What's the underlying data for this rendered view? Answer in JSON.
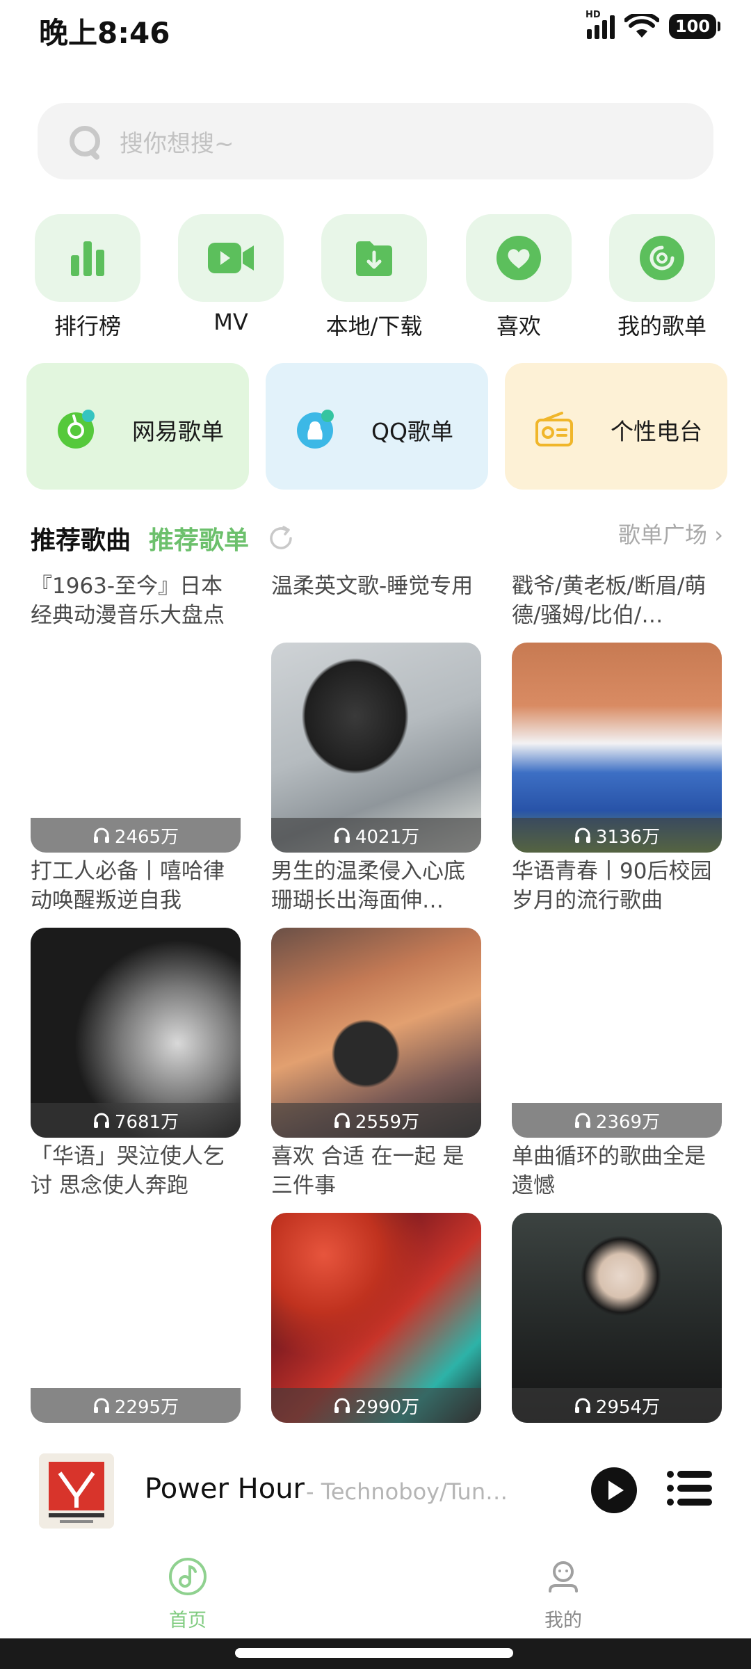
{
  "status_bar": {
    "time": "晚上8:46",
    "battery": "100",
    "network": "HD"
  },
  "search": {
    "placeholder": "搜你想搜~"
  },
  "quick_entries": [
    {
      "label": "排行榜",
      "icon": "chart-bars-icon"
    },
    {
      "label": "MV",
      "icon": "video-camera-icon"
    },
    {
      "label": "本地/下载",
      "icon": "download-folder-icon"
    },
    {
      "label": "喜欢",
      "icon": "heart-icon"
    },
    {
      "label": "我的歌单",
      "icon": "disc-icon"
    }
  ],
  "sources": [
    {
      "label": "网易歌单",
      "icon": "netease-icon",
      "color": "#e2f6de"
    },
    {
      "label": "QQ歌单",
      "icon": "qq-icon",
      "color": "#e2f2fa"
    },
    {
      "label": "个性电台",
      "icon": "radio-icon",
      "color": "#fdf1d6"
    }
  ],
  "section": {
    "tab_songs": "推荐歌曲",
    "tab_playlists": "推荐歌单",
    "more": "歌单广场 ›"
  },
  "playlists": [
    {
      "title": "『1963-至今』日本经典动漫音乐大盘点",
      "count": "2465万",
      "has_cover": false
    },
    {
      "title": "温柔英文歌-睡觉专用",
      "count": "4021万",
      "has_cover": true
    },
    {
      "title": "戳爷/黄老板/断眉/萌德/骚姆/比伯/…",
      "count": "3136万",
      "has_cover": true
    },
    {
      "title": "打工人必备丨嘻哈律动唤醒叛逆自我",
      "count": "7681万",
      "has_cover": true
    },
    {
      "title": "男生的温柔侵入心底珊瑚长出海面伸…",
      "count": "2559万",
      "has_cover": true
    },
    {
      "title": "华语青春丨90后校园岁月的流行歌曲",
      "count": "2369万",
      "has_cover": false
    },
    {
      "title": "「华语」哭泣使人乞讨 思念使人奔跑",
      "count": "2295万",
      "has_cover": false
    },
    {
      "title": "喜欢 合适 在一起 是三件事",
      "count": "2990万",
      "has_cover": true
    },
    {
      "title": "单曲循环的歌曲全是遗憾",
      "count": "2954万",
      "has_cover": true
    }
  ],
  "player": {
    "title": "Power Hour",
    "artist": "- Technoboy/Tun…"
  },
  "nav": [
    {
      "label": "首页",
      "active": true
    },
    {
      "label": "我的",
      "active": false
    }
  ],
  "colors": {
    "accent": "#6cc06c",
    "tile": "#e8f6e8"
  }
}
